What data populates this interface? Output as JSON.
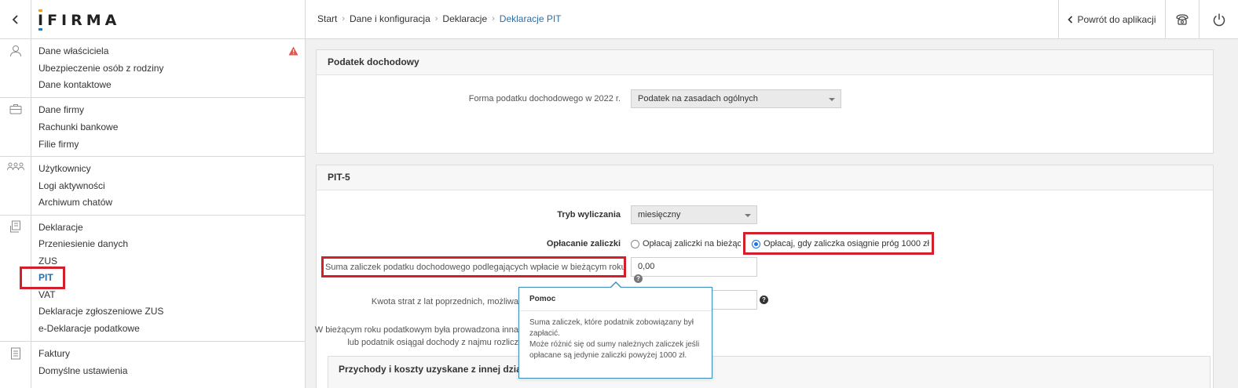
{
  "header": {
    "logo": "IFIRMA",
    "breadcrumb": [
      "Start",
      "Dane i konfiguracja",
      "Deklaracje",
      "Deklaracje PIT"
    ],
    "return_label": "Powrót do aplikacji"
  },
  "sidebar": {
    "groups": [
      {
        "icon": "user-icon",
        "items": [
          "Dane właściciela",
          "Ubezpieczenie osób z rodziny",
          "Dane kontaktowe"
        ]
      },
      {
        "icon": "briefcase-icon",
        "items": [
          "Dane firmy",
          "Rachunki bankowe",
          "Filie firmy"
        ]
      },
      {
        "icon": "users-icon",
        "items": [
          "Użytkownicy",
          "Logi aktywności",
          "Archiwum chatów"
        ]
      },
      {
        "icon": "declarations-icon",
        "items": [
          "Deklaracje",
          "Przeniesienie danych",
          "ZUS",
          "PIT",
          "VAT",
          "Deklaracje zgłoszeniowe ZUS",
          "e-Deklaracje podatkowe"
        ]
      },
      {
        "icon": "invoice-icon",
        "items": [
          "Faktury",
          "Domyślne ustawienia"
        ]
      }
    ],
    "active_item": "PIT"
  },
  "income_tax": {
    "title": "Podatek dochodowy",
    "form_label": "Forma podatku dochodowego w 2022 r.",
    "form_value": "Podatek na zasadach ogólnych"
  },
  "pit5": {
    "title": "PIT-5",
    "mode_label": "Tryb wyliczania",
    "mode_value": "miesięczny",
    "payment_label": "Opłacanie zaliczki",
    "payment_option_1": "Opłacaj zaliczki na bieżąco",
    "payment_option_2": "Opłacaj, gdy zaliczka osiągnie próg 1000 zł",
    "sum_label": "Suma zaliczek podatku dochodowego podlegających wpłacie w bieżącym roku",
    "sum_value": "0,00",
    "losses_label": "Kwota strat z lat poprzednich, możliwa",
    "note_line_1": "W bieżącym roku podatkowym była prowadzona inna",
    "note_line_2": "lub podatnik osiągał dochody z najmu rozlicz",
    "other_activity_title": "Przychody i koszty uzyskane z innej działal"
  },
  "tooltip": {
    "title": "Pomoc",
    "body_1": "Suma zaliczek, które podatnik zobowiązany był zapłacić.",
    "body_2": "Może różnić się od sumy należnych zaliczek jeśli opłacane są jedynie zaliczki powyżej 1000 zł."
  },
  "colors": {
    "accent": "#2e6da4",
    "highlight": "#d2202b",
    "tooltip_border": "#3c8dbc"
  }
}
